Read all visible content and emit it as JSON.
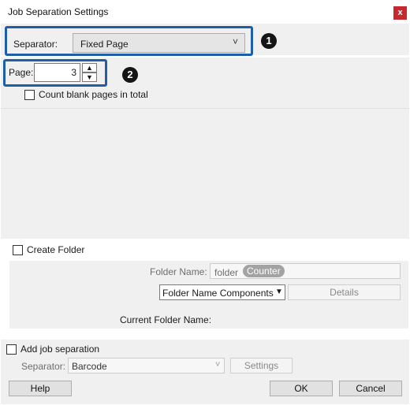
{
  "window": {
    "title": "Job Separation Settings",
    "close_glyph": "x"
  },
  "separator": {
    "label": "Separator:",
    "value": "Fixed Page",
    "chevron": "˅"
  },
  "page": {
    "label": "Page:",
    "value": "3",
    "up_glyph": "▲",
    "down_glyph": "▼"
  },
  "count_blank": {
    "label": "Count blank pages in total",
    "checked": false
  },
  "callouts": {
    "one": "1",
    "two": "2"
  },
  "create_folder": {
    "label": "Create Folder",
    "checked": false,
    "folder_name_label": "Folder Name:",
    "folder_name_text": "folder",
    "folder_name_tag": "Counter",
    "components_label": "Folder Name Components",
    "components_arrow": "▼",
    "details_label": "Details",
    "current_folder_label": "Current Folder Name:"
  },
  "job_separation": {
    "label": "Add job separation",
    "checked": false,
    "separator_label": "Separator:",
    "separator_value": "Barcode",
    "separator_chevron": "˅",
    "settings_label": "Settings"
  },
  "footer": {
    "help_label": "Help",
    "ok_label": "OK",
    "cancel_label": "Cancel"
  },
  "colors": {
    "callout_border": "#1f5fa8",
    "close_button": "#c5282f",
    "panel": "#f0f0f0"
  }
}
